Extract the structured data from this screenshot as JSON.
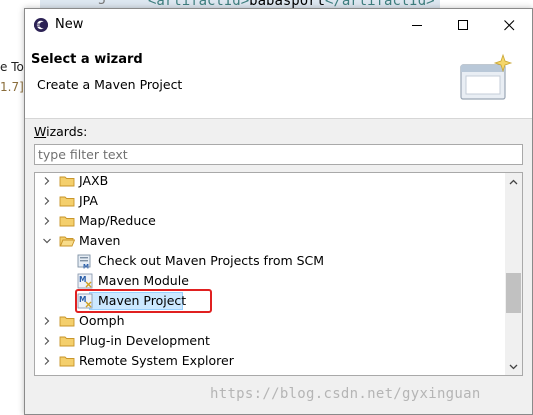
{
  "background": {
    "line_number": "5",
    "code_open_tag": "<artifactId>",
    "code_value": "babasport",
    "code_close_tag": "</artifactId>",
    "left_fragment_1": "e To",
    "left_fragment_2": "1.7]"
  },
  "dialog": {
    "title": "New",
    "header_title": "Select a wizard",
    "header_description": "Create a Maven Project",
    "wizards_label_underlined": "W",
    "wizards_label_rest": "izards:",
    "filter_placeholder": "type filter text",
    "filter_value": ""
  },
  "tree": {
    "items": [
      {
        "label": "JAXB",
        "type": "folder",
        "expanded": false,
        "level": 0
      },
      {
        "label": "JPA",
        "type": "folder",
        "expanded": false,
        "level": 0
      },
      {
        "label": "Map/Reduce",
        "type": "folder",
        "expanded": false,
        "level": 0
      },
      {
        "label": "Maven",
        "type": "folder",
        "expanded": true,
        "level": 0
      },
      {
        "label": "Check out Maven Projects from SCM",
        "type": "maven-scm",
        "level": 1
      },
      {
        "label": "Maven Module",
        "type": "maven",
        "level": 1
      },
      {
        "label": "Maven Project",
        "type": "maven",
        "level": 1,
        "selected": true
      },
      {
        "label": "Oomph",
        "type": "folder",
        "expanded": false,
        "level": 0
      },
      {
        "label": "Plug-in Development",
        "type": "folder",
        "expanded": false,
        "level": 0
      },
      {
        "label": "Remote System Explorer",
        "type": "folder",
        "expanded": false,
        "level": 0
      }
    ]
  },
  "watermark": "https://blog.csdn.net/gyxinguan",
  "colors": {
    "selection_highlight": "#cce8ff",
    "annotation_box": "#e02020",
    "folder": "#e8b440"
  },
  "icons": {
    "app": "eclipse-icon",
    "minimize": "minimize-icon",
    "maximize": "maximize-icon",
    "close": "close-icon",
    "banner": "wizard-banner-icon"
  }
}
